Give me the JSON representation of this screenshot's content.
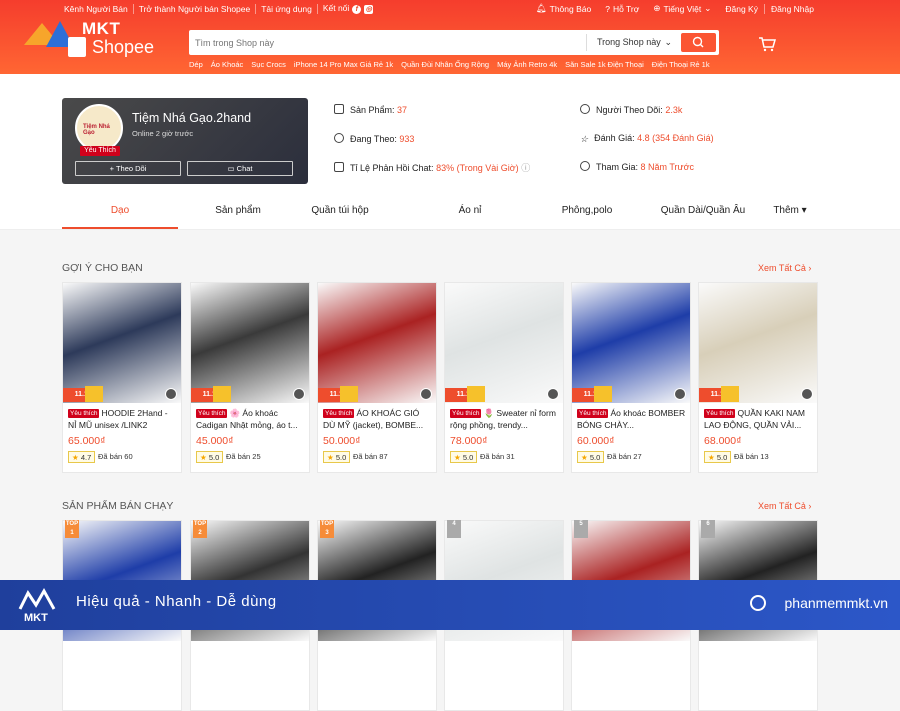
{
  "topbar": {
    "left": [
      "Kênh Người Bán",
      "Trở thành Người bán Shopee",
      "Tải ứng dụng",
      "Kết nối"
    ],
    "notif": "Thông Báo",
    "help": "Hỗ Trợ",
    "lang": "Tiếng Việt",
    "register": "Đăng Ký",
    "login": "Đăng Nhập"
  },
  "logo": {
    "brand": "MKT",
    "app": "Shopee"
  },
  "search": {
    "placeholder": "Tìm trong Shop này",
    "scope": "Trong Shop này"
  },
  "suggestions": [
    "Dép",
    "Áo Khoác",
    "Sục Crocs",
    "iPhone 14 Pro Max Giá Rẻ 1k",
    "Quần Đùi Nhân Ống Rộng",
    "Máy Ảnh Retro 4k",
    "Săn Sale 1k Điện Thoại",
    "Điện Thoại Rẻ 1k"
  ],
  "shop": {
    "name": "Tiệm Nhá Gạo.2hand",
    "online": "Online 2 giờ trước",
    "badge": "Yêu Thích",
    "avatar_text": "Tiệm Nhá Gạo",
    "follow": "+ Theo Dõi",
    "chat": "Chat"
  },
  "stats": [
    {
      "label": "Sản Phẩm:",
      "value": "37"
    },
    {
      "label": "Đang Theo:",
      "value": "933"
    },
    {
      "label": "Tỉ Lệ Phản Hồi Chat:",
      "value": "83% (Trong Vài Giờ)"
    },
    {
      "label": "Người Theo Dõi:",
      "value": "2.3k"
    },
    {
      "label": "Đánh Giá:",
      "value": "4.8 (354 Đánh Giá)"
    },
    {
      "label": "Tham Gia:",
      "value": "8 Năm Trước"
    }
  ],
  "tabs": [
    "Dạo",
    "Sản phẩm",
    "Quần túi hộp",
    "Áo nỉ",
    "Phông,polo",
    "Quần Dài/Quần Âu",
    "Thêm"
  ],
  "sections": {
    "suggested": "GỢI Ý CHO BẠN",
    "bestsellers": "SẢN PHẨM BÁN CHẠY",
    "see_all": "Xem Tất Cả"
  },
  "fav_label": "Yêu thích",
  "sale_label": "11.11",
  "products": [
    {
      "title": "HOODIE 2Hand - NỈ MŨ unisex /LINK2",
      "price": "65.000₫",
      "rating": "4.7",
      "sold": "Đã bán 60",
      "color": "#2d3a5a"
    },
    {
      "title": "🌸 Áo khoác Cadigan Nhật mỏng, áo t...",
      "price": "45.000₫",
      "rating": "5.0",
      "sold": "Đã bán 25",
      "color": "#3a3a3a"
    },
    {
      "title": "ÁO KHOÁC GIÓ DÙ MỸ (jacket), BOMBE...",
      "price": "50.000₫",
      "rating": "5.0",
      "sold": "Đã bán 87",
      "color": "#a22"
    },
    {
      "title": "🌷 Sweater nỉ form rộng phồng, trendy...",
      "price": "78.000₫",
      "rating": "5.0",
      "sold": "Đã bán 31",
      "color": "#dfe3e3"
    },
    {
      "title": "Áo khoác BOMBER BÓNG CHÀY...",
      "price": "60.000₫",
      "rating": "5.0",
      "sold": "Đã bán 27",
      "color": "#1e3da8"
    },
    {
      "title": "QUẦN KAKI NAM LAO ĐỘNG, QUẦN VẢI...",
      "price": "68.000₫",
      "rating": "5.0",
      "sold": "Đã bán 13",
      "color": "#d8cfb9"
    }
  ],
  "top_labels": [
    "TOP 1",
    "TOP 2",
    "TOP 3",
    "4",
    "5",
    "6"
  ],
  "best_colors": [
    "#1e3da8",
    "#333",
    "#222",
    "#dfe3e3",
    "#a22",
    "#222"
  ],
  "footer": {
    "slogan": "Hiệu quả - Nhanh  - Dễ dùng",
    "site": "phanmemmkt.vn",
    "logo": "MKT"
  }
}
